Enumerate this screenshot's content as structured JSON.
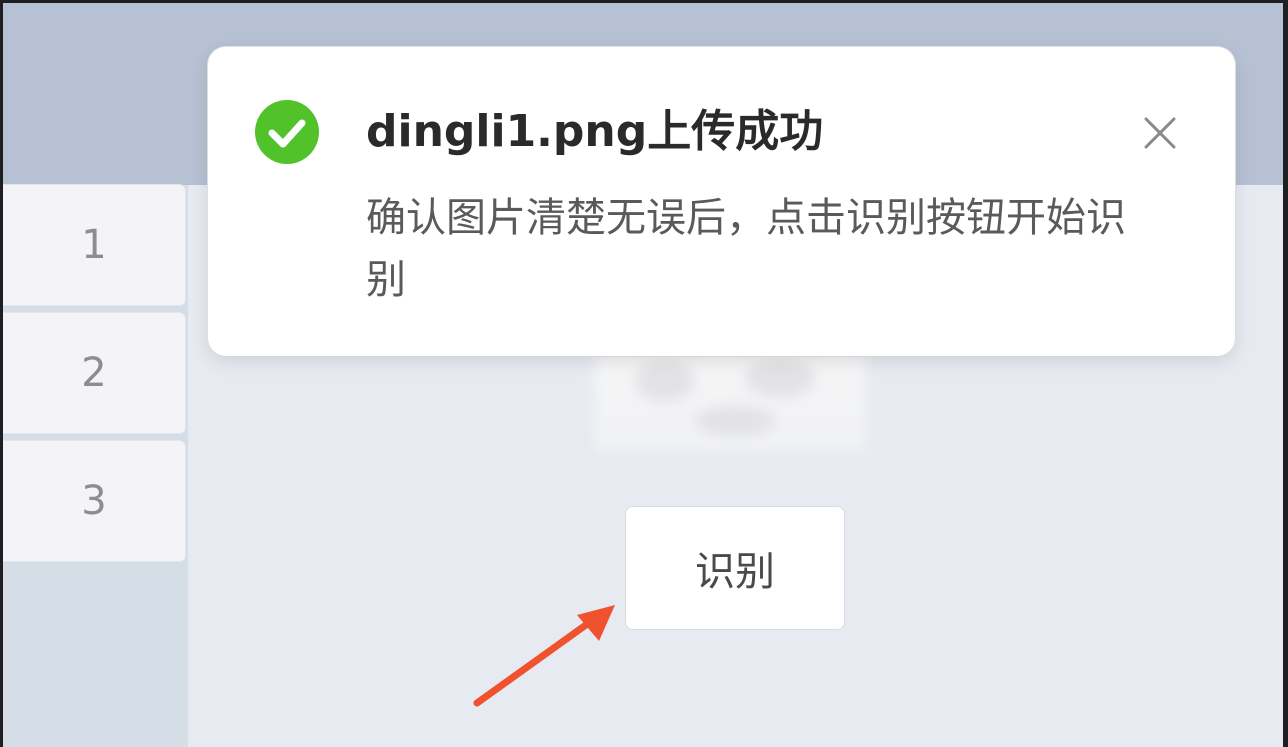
{
  "sidebar": {
    "items": [
      {
        "label": "1"
      },
      {
        "label": "2"
      },
      {
        "label": "3"
      }
    ]
  },
  "main": {
    "recognize_label": "识别"
  },
  "toast": {
    "title": "dingli1.png上传成功",
    "message": "确认图片清楚无误后，点击识别按钮开始识别",
    "icon": "check-circle-icon",
    "close_icon": "close-icon",
    "success_color": "#52c22b"
  },
  "annotation": {
    "arrow_color": "#f0522f"
  }
}
